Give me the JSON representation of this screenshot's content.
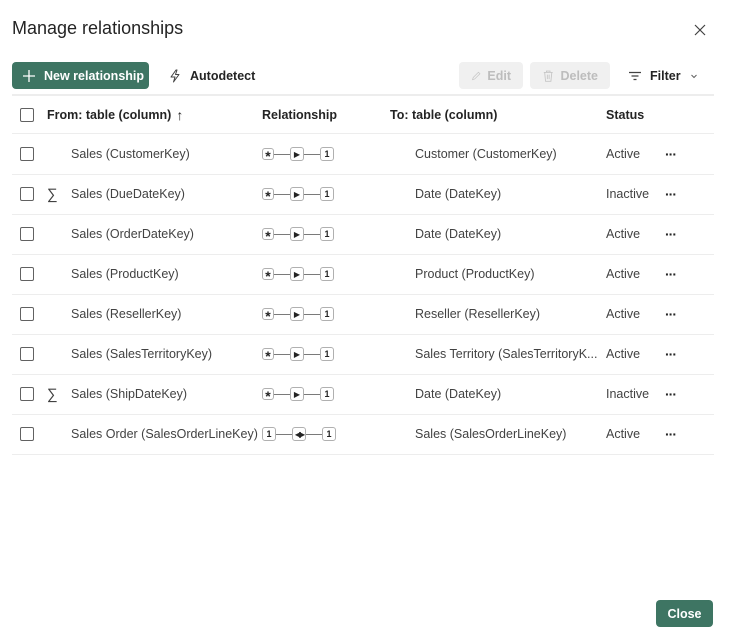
{
  "dialog": {
    "title": "Manage relationships",
    "close_icon": "close-icon"
  },
  "toolbar": {
    "new_relationship_label": "New relationship",
    "autodetect_label": "Autodetect",
    "edit_label": "Edit",
    "delete_label": "Delete",
    "filter_label": "Filter"
  },
  "table": {
    "columns": {
      "from": "From: table (column)",
      "sort_indicator": "↑",
      "relationship": "Relationship",
      "to": "To: table (column)",
      "status": "Status"
    },
    "rows": [
      {
        "from": "Sales (CustomerKey)",
        "measure": false,
        "from_card": "*",
        "direction": "single",
        "to_card": "1",
        "to": "Customer (CustomerKey)",
        "status": "Active"
      },
      {
        "from": "Sales (DueDateKey)",
        "measure": true,
        "from_card": "*",
        "direction": "single",
        "to_card": "1",
        "to": "Date (DateKey)",
        "status": "Inactive"
      },
      {
        "from": "Sales (OrderDateKey)",
        "measure": false,
        "from_card": "*",
        "direction": "single",
        "to_card": "1",
        "to": "Date (DateKey)",
        "status": "Active"
      },
      {
        "from": "Sales (ProductKey)",
        "measure": false,
        "from_card": "*",
        "direction": "single",
        "to_card": "1",
        "to": "Product (ProductKey)",
        "status": "Active"
      },
      {
        "from": "Sales (ResellerKey)",
        "measure": false,
        "from_card": "*",
        "direction": "single",
        "to_card": "1",
        "to": "Reseller (ResellerKey)",
        "status": "Active"
      },
      {
        "from": "Sales (SalesTerritoryKey)",
        "measure": false,
        "from_card": "*",
        "direction": "single",
        "to_card": "1",
        "to": "Sales Territory (SalesTerritoryK...",
        "status": "Active"
      },
      {
        "from": "Sales (ShipDateKey)",
        "measure": true,
        "from_card": "*",
        "direction": "single",
        "to_card": "1",
        "to": "Date (DateKey)",
        "status": "Inactive"
      },
      {
        "from": "Sales Order (SalesOrderLineKey)",
        "measure": false,
        "from_card": "1",
        "direction": "both",
        "to_card": "1",
        "to": "Sales (SalesOrderLineKey)",
        "status": "Active"
      }
    ],
    "more_label": "···",
    "measure_symbol": "∑"
  },
  "footer": {
    "close_label": "Close"
  },
  "colors": {
    "primary": "#3e7563",
    "disabled_bg": "#f0f0f0",
    "disabled_text": "#bdbdbd"
  }
}
